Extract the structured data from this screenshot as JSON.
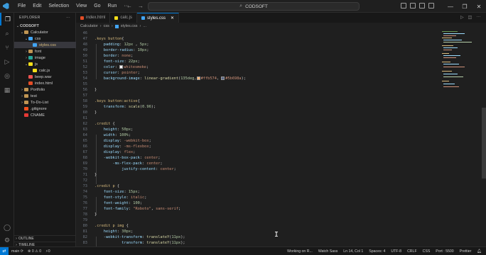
{
  "titlebar": {
    "menu": [
      "File",
      "Edit",
      "Selection",
      "View",
      "Go",
      "Run",
      "···"
    ],
    "nav_back": "←",
    "nav_forward": "→",
    "command_center": "CODSOFT",
    "window_controls": [
      "—",
      "❐",
      "✕"
    ]
  },
  "activity_icons": [
    "explorer-icon",
    "search-icon",
    "source-control-icon",
    "run-debug-icon",
    "remote-icon",
    "extensions-icon",
    "account-icon",
    "settings-icon"
  ],
  "sidebar": {
    "title": "EXPLORER",
    "more": "···",
    "tree": [
      {
        "label": "CODSOFT",
        "depth": 0,
        "chevron": "⌄",
        "icon": "",
        "bold": true
      },
      {
        "label": "Calculator",
        "depth": 1,
        "chevron": "⌄",
        "icon": "folder"
      },
      {
        "label": "css",
        "depth": 2,
        "chevron": "⌄",
        "icon": "folder css"
      },
      {
        "label": "styles.css",
        "depth": 3,
        "chevron": "",
        "icon": "f-css",
        "selected": true
      },
      {
        "label": "font",
        "depth": 2,
        "chevron": "›",
        "icon": "folder"
      },
      {
        "label": "image",
        "depth": 2,
        "chevron": "›",
        "icon": "folder img"
      },
      {
        "label": "js",
        "depth": 2,
        "chevron": "⌄",
        "icon": "folder js"
      },
      {
        "label": "calc.js",
        "depth": 3,
        "chevron": "",
        "icon": "f-js"
      },
      {
        "label": "beep.wav",
        "depth": 2,
        "chevron": "",
        "icon": "f-wav"
      },
      {
        "label": "index.html",
        "depth": 2,
        "chevron": "",
        "icon": "f-html"
      },
      {
        "label": "Portfolio",
        "depth": 1,
        "chevron": "›",
        "icon": "folder"
      },
      {
        "label": "test",
        "depth": 1,
        "chevron": "›",
        "icon": "folder"
      },
      {
        "label": "To-Do-List",
        "depth": 1,
        "chevron": "›",
        "icon": "folder"
      },
      {
        "label": ".gitignore",
        "depth": 1,
        "chevron": "",
        "icon": "f-git"
      },
      {
        "label": "CNAME",
        "depth": 1,
        "chevron": "",
        "icon": "f-cname"
      }
    ],
    "outline": "OUTLINE",
    "timeline": "TIMELINE"
  },
  "tabs": [
    {
      "label": "index.html",
      "icon": "f-html",
      "active": false
    },
    {
      "label": "calc.js",
      "icon": "f-js",
      "active": false
    },
    {
      "label": "styles.css",
      "icon": "f-css",
      "active": true,
      "close": "✕"
    }
  ],
  "breadcrumb": [
    "Calculator",
    "css",
    "styles.css",
    "..."
  ],
  "editor": {
    "lines": [
      {
        "n": "46",
        "t": []
      },
      {
        "n": "47",
        "t": [
          [
            "sel",
            ".keys button"
          ],
          [
            "punc",
            "{"
          ]
        ]
      },
      {
        "n": "48",
        "t": [
          [
            "ind",
            "    "
          ],
          [
            "prop",
            "padding"
          ],
          [
            "punc",
            ": "
          ],
          [
            "num",
            "12px"
          ],
          [
            "punc",
            " , "
          ],
          [
            "num",
            "5px"
          ],
          [
            "punc",
            ";"
          ]
        ]
      },
      {
        "n": "49",
        "t": [
          [
            "ind",
            "    "
          ],
          [
            "prop",
            "border-radius"
          ],
          [
            "punc",
            ": "
          ],
          [
            "num",
            "10px"
          ],
          [
            "punc",
            ";"
          ]
        ]
      },
      {
        "n": "50",
        "t": [
          [
            "ind",
            "    "
          ],
          [
            "prop",
            "border"
          ],
          [
            "punc",
            ": "
          ],
          [
            "val",
            "none"
          ],
          [
            "punc",
            ";"
          ]
        ]
      },
      {
        "n": "51",
        "t": [
          [
            "ind",
            "    "
          ],
          [
            "prop",
            "font-size"
          ],
          [
            "punc",
            ": "
          ],
          [
            "num",
            "22px"
          ],
          [
            "punc",
            ";"
          ]
        ]
      },
      {
        "n": "52",
        "t": [
          [
            "ind",
            "    "
          ],
          [
            "prop",
            "color"
          ],
          [
            "punc",
            ": "
          ],
          [
            "sw",
            "#f5f5f5"
          ],
          [
            "val",
            "whitesmoke"
          ],
          [
            "punc",
            ";"
          ]
        ]
      },
      {
        "n": "53",
        "t": [
          [
            "ind",
            "    "
          ],
          [
            "prop",
            "cursor"
          ],
          [
            "punc",
            ": "
          ],
          [
            "val",
            "pointer"
          ],
          [
            "punc",
            ";"
          ]
        ]
      },
      {
        "n": "54",
        "t": [
          [
            "ind",
            "    "
          ],
          [
            "prop",
            "background-image"
          ],
          [
            "punc",
            ": "
          ],
          [
            "fn",
            "linear-gradient"
          ],
          [
            "punc",
            "("
          ],
          [
            "num",
            "135deg"
          ],
          [
            "punc",
            ","
          ],
          [
            "sw",
            "#ffb574"
          ],
          [
            "val",
            "#ffb574"
          ],
          [
            "punc",
            ", "
          ],
          [
            "sw",
            "#5b698a"
          ],
          [
            "val",
            "#5b698a"
          ],
          [
            "punc",
            ");"
          ]
        ]
      },
      {
        "n": "55",
        "t": []
      },
      {
        "n": "56",
        "t": [
          [
            "punc",
            "}"
          ]
        ]
      },
      {
        "n": "57",
        "t": []
      },
      {
        "n": "58",
        "t": [
          [
            "sel",
            ".keys button:active"
          ],
          [
            "punc",
            "{"
          ]
        ]
      },
      {
        "n": "59",
        "t": [
          [
            "ind",
            "    "
          ],
          [
            "prop",
            "transform"
          ],
          [
            "punc",
            ": "
          ],
          [
            "fn",
            "scale"
          ],
          [
            "punc",
            "("
          ],
          [
            "num",
            "0.96"
          ],
          [
            "punc",
            ");"
          ]
        ]
      },
      {
        "n": "60",
        "t": [
          [
            "punc",
            "}"
          ]
        ]
      },
      {
        "n": "61",
        "t": []
      },
      {
        "n": "62",
        "t": [
          [
            "sel",
            ".credit "
          ],
          [
            "punc",
            "{"
          ]
        ]
      },
      {
        "n": "63",
        "t": [
          [
            "ind",
            "    "
          ],
          [
            "prop",
            "height"
          ],
          [
            "punc",
            ": "
          ],
          [
            "num",
            "50px"
          ],
          [
            "punc",
            ";"
          ]
        ]
      },
      {
        "n": "64",
        "t": [
          [
            "ind",
            "    "
          ],
          [
            "prop",
            "width"
          ],
          [
            "punc",
            ": "
          ],
          [
            "num",
            "100%"
          ],
          [
            "punc",
            ";"
          ]
        ]
      },
      {
        "n": "65",
        "t": [
          [
            "ind",
            "    "
          ],
          [
            "prop",
            "display"
          ],
          [
            "punc",
            ": "
          ],
          [
            "val",
            "-webkit-box"
          ],
          [
            "punc",
            ";"
          ]
        ]
      },
      {
        "n": "66",
        "t": [
          [
            "ind",
            "    "
          ],
          [
            "prop",
            "display"
          ],
          [
            "punc",
            ": "
          ],
          [
            "val",
            "-ms-flexbox"
          ],
          [
            "punc",
            ";"
          ]
        ]
      },
      {
        "n": "67",
        "t": [
          [
            "ind",
            "    "
          ],
          [
            "prop",
            "display"
          ],
          [
            "punc",
            ": "
          ],
          [
            "val",
            "flex"
          ],
          [
            "punc",
            ";"
          ]
        ]
      },
      {
        "n": "68",
        "t": [
          [
            "ind",
            "    "
          ],
          [
            "prop",
            "-webkit-box-pack"
          ],
          [
            "punc",
            ": "
          ],
          [
            "val",
            "center"
          ],
          [
            "punc",
            ";"
          ]
        ]
      },
      {
        "n": "69",
        "t": [
          [
            "ind",
            "        "
          ],
          [
            "prop",
            "-ms-flex-pack"
          ],
          [
            "punc",
            ": "
          ],
          [
            "val",
            "center"
          ],
          [
            "punc",
            ";"
          ]
        ]
      },
      {
        "n": "70",
        "t": [
          [
            "ind",
            "            "
          ],
          [
            "prop",
            "justify-content"
          ],
          [
            "punc",
            ": "
          ],
          [
            "val",
            "center"
          ],
          [
            "punc",
            ";"
          ]
        ]
      },
      {
        "n": "71",
        "t": [
          [
            "punc",
            "}"
          ]
        ]
      },
      {
        "n": "72",
        "t": []
      },
      {
        "n": "73",
        "t": [
          [
            "sel",
            ".credit p "
          ],
          [
            "punc",
            "{"
          ]
        ]
      },
      {
        "n": "74",
        "t": [
          [
            "ind",
            "    "
          ],
          [
            "prop",
            "font-size"
          ],
          [
            "punc",
            ": "
          ],
          [
            "num",
            "15px"
          ],
          [
            "punc",
            ";"
          ]
        ]
      },
      {
        "n": "75",
        "t": [
          [
            "ind",
            "    "
          ],
          [
            "prop",
            "font-style"
          ],
          [
            "punc",
            ": "
          ],
          [
            "val",
            "italic"
          ],
          [
            "punc",
            ";"
          ]
        ]
      },
      {
        "n": "76",
        "t": [
          [
            "ind",
            "    "
          ],
          [
            "prop",
            "font-weight"
          ],
          [
            "punc",
            ": "
          ],
          [
            "num",
            "100"
          ],
          [
            "punc",
            ";"
          ]
        ]
      },
      {
        "n": "77",
        "t": [
          [
            "ind",
            "    "
          ],
          [
            "prop",
            "font-family"
          ],
          [
            "punc",
            ": "
          ],
          [
            "val",
            "\"Roboto\""
          ],
          [
            "punc",
            ", "
          ],
          [
            "val",
            "sans-serif"
          ],
          [
            "punc",
            ";"
          ]
        ]
      },
      {
        "n": "78",
        "t": [
          [
            "punc",
            "}"
          ]
        ]
      },
      {
        "n": "79",
        "t": []
      },
      {
        "n": "80",
        "t": [
          [
            "sel",
            ".credit p img "
          ],
          [
            "punc",
            "{"
          ]
        ]
      },
      {
        "n": "81",
        "t": [
          [
            "ind",
            "    "
          ],
          [
            "prop",
            "height"
          ],
          [
            "punc",
            ": "
          ],
          [
            "num",
            "30px"
          ],
          [
            "punc",
            ";"
          ]
        ]
      },
      {
        "n": "82",
        "t": [
          [
            "ind",
            "    "
          ],
          [
            "prop",
            "-webkit-transform"
          ],
          [
            "punc",
            ": "
          ],
          [
            "fn",
            "translateY"
          ],
          [
            "punc",
            "("
          ],
          [
            "num",
            "11px"
          ],
          [
            "punc",
            ");"
          ]
        ]
      },
      {
        "n": "83",
        "t": [
          [
            "ind",
            "            "
          ],
          [
            "prop",
            "transform"
          ],
          [
            "punc",
            ": "
          ],
          [
            "fn",
            "translateY"
          ],
          [
            "punc",
            "("
          ],
          [
            "num",
            "11px"
          ],
          [
            "punc",
            ");"
          ]
        ]
      }
    ]
  },
  "statusbar": {
    "remote": "⇄",
    "branch": "main ⟳",
    "problems": "⊗ 0 ⚠ 0",
    "ports": "⚡0",
    "working": "Working on R...",
    "watch_sass": "Watch Sass",
    "position": "Ln 14, Col 1",
    "spaces": "Spaces: 4",
    "encoding": "UTF-8",
    "eol": "CRLF",
    "language": "CSS",
    "port": "Port : 5500",
    "prettier": "Prettier"
  },
  "colors": {
    "accent": "#0078d4",
    "swatch_whitesmoke": "#f5f5f5",
    "swatch_orange": "#ffb574",
    "swatch_slate": "#5b698a"
  }
}
